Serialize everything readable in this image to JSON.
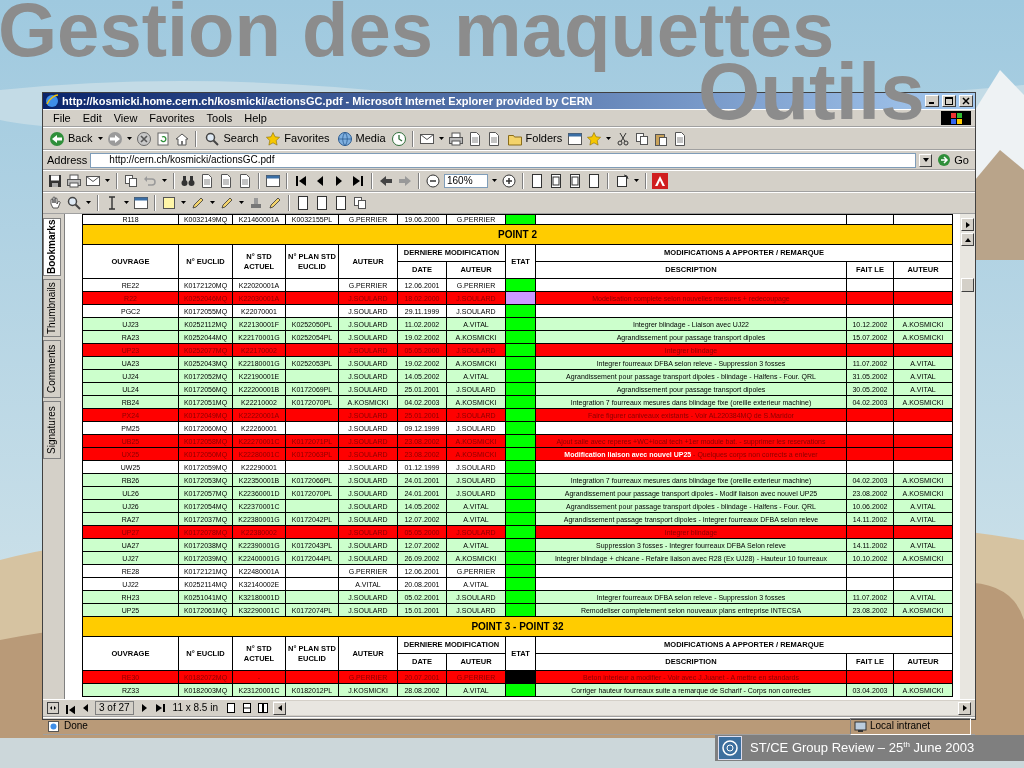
{
  "slide": {
    "title": "Gestion des maquettes",
    "subtitle": "Outils",
    "footer": "ST/CE Group Review – 25$^{th}$ June 2003"
  },
  "window": {
    "title": "http://kosmicki.home.cern.ch/kosmicki/actionsGC.pdf - Microsoft Internet Explorer provided by CERN",
    "menu": [
      "File",
      "Edit",
      "View",
      "Favorites",
      "Tools",
      "Help"
    ],
    "toolbar": [
      "Back",
      "Search",
      "Favorites",
      "Media",
      "Folders"
    ],
    "address": {
      "label": "Address",
      "url": "http://cern.ch/kosmicki/actionsGC.pdf",
      "go": "Go"
    },
    "zoom": "160%",
    "side_tabs": [
      {
        "label": "Bookmarks",
        "selected": true
      },
      {
        "label": "Thumbnails",
        "selected": false
      },
      {
        "label": "Comments",
        "selected": false
      },
      {
        "label": "Signatures",
        "selected": false
      }
    ],
    "document": {
      "top_row": {
        "ouvrage": "R118",
        "euclid": "K0032149MQ",
        "std": "K21460001A",
        "plan": "K0032155PL",
        "auteur": "G.PERRIER",
        "date": "19.06.2000",
        "modif_auteur": "G.PERRIER",
        "etat": {
          "color": "#00ff00"
        },
        "color": "#ffffff"
      },
      "sections": [
        {
          "title": "POINT 2",
          "header": {
            "ouvrage": "OUVRAGE",
            "euclid": "N° EUCLID",
            "std": "N° STD ACTUEL",
            "plan": "N° PLAN STD EUCLID",
            "auteur": "AUTEUR",
            "derniere": "DERNIERE MODIFICATION",
            "date": "DATE",
            "modif_auteur": "AUTEUR",
            "etat": "ETAT",
            "modifications": "MODIFICATIONS A APPORTER / REMARQUE",
            "description": "DESCRIPTION",
            "fait_le": "FAIT LE",
            "remarque_auteur": "AUTEUR"
          },
          "rows": [
            {
              "ouvrage": "RE22",
              "euclid": "K0172120MQ",
              "std": "K22020001A",
              "auteur": "G.PERRIER",
              "date": "12.06.2001",
              "modif_auteur": "G.PERRIER",
              "etat": {
                "color": "#00ff00"
              },
              "color": "#ffffff"
            },
            {
              "ouvrage": "R22",
              "euclid": "K0252046MQ",
              "std": "K22030001A",
              "auteur": "J.SOULARD",
              "date": "18.02.2000",
              "modif_auteur": "J.SOULARD",
              "etat": {
                "color": "#cc99ff"
              },
              "description": "Modelisation complete selon nouvelles mesures + redecoupage",
              "color": "#ff0000"
            },
            {
              "ouvrage": "PGC2",
              "euclid": "K0172055MQ",
              "std": "K22070001",
              "auteur": "J.SOULARD",
              "date": "29.11.1999",
              "modif_auteur": "J.SOULARD",
              "etat": {
                "color": "#00ff00"
              },
              "color": "#ffffff"
            },
            {
              "ouvrage": "UJ23",
              "euclid": "K0252112MQ",
              "std": "K22130001F",
              "plan": "K0252050PL",
              "auteur": "J.SOULARD",
              "date": "11.02.2002",
              "modif_auteur": "A.VITAL",
              "etat": {
                "color": "#00ff00"
              },
              "description": "Integrer blindage - Liaison avec UJ22",
              "fait_le": "10.12.2002",
              "remarque_auteur": "A.KOSMICKI",
              "color": "#ccffcc"
            },
            {
              "ouvrage": "RA23",
              "euclid": "K0252044MQ",
              "std": "K22170001G",
              "plan": "K0252054PL",
              "auteur": "J.SOULARD",
              "date": "19.02.2002",
              "modif_auteur": "A.KOSMICKI",
              "etat": {
                "color": "#00ff00"
              },
              "description": "Agrandissement pour passage transport dipoles",
              "fait_le": "15.07.2002",
              "remarque_auteur": "A.KOSMICKI",
              "color": "#ccffcc"
            },
            {
              "ouvrage": "UP23",
              "euclid": "K0252077MQ",
              "std": "K22170002",
              "auteur": "J.SOULARD",
              "date": "05.05.2000",
              "modif_auteur": "J.SOULARD",
              "etat": {
                "color": "#00ff00"
              },
              "description": "Integrer blindage",
              "color": "#ff0000"
            },
            {
              "ouvrage": "UA23",
              "euclid": "K0252043MQ",
              "std": "K22180001G",
              "plan": "K0252053PL",
              "auteur": "J.SOULARD",
              "date": "19.02.2002",
              "modif_auteur": "A.KOSMICKI",
              "etat": {
                "color": "#00ff00"
              },
              "description": "Integrer fourreaux DFBA selon releve - Suppression 3 fosses",
              "fait_le": "11.07.2002",
              "remarque_auteur": "A.VITAL",
              "color": "#ccffcc"
            },
            {
              "ouvrage": "UJ24",
              "euclid": "K0172052MQ",
              "std": "K22190001E",
              "auteur": "J.SOULARD",
              "date": "14.05.2002",
              "modif_auteur": "A.VITAL",
              "etat": {
                "color": "#00ff00"
              },
              "description": "Agrandissement pour passage transport dipoles - blindage - Halfens - Four. QRL",
              "fait_le": "31.05.2002",
              "remarque_auteur": "A.VITAL",
              "color": "#ccffcc"
            },
            {
              "ouvrage": "UL24",
              "euclid": "K0172056MQ",
              "std": "K22200001B",
              "plan": "K0172069PL",
              "auteur": "J.SOULARD",
              "date": "25.01.2001",
              "modif_auteur": "J.SOULARD",
              "etat": {
                "color": "#00ff00"
              },
              "description": "Agrandissement pour passage transport dipoles",
              "fait_le": "30.05.2002",
              "remarque_auteur": "A.VITAL",
              "color": "#ccffcc"
            },
            {
              "ouvrage": "RB24",
              "euclid": "K0172051MQ",
              "std": "K22210002",
              "plan": "K0172070PL",
              "auteur": "A.KOSMICKI",
              "date": "04.02.2003",
              "modif_auteur": "A.KOSMICKI",
              "etat": {
                "color": "#00ff00"
              },
              "description": "Integration 7 fourreaux mesures dans blindage fixe (oreille exterieur machine)",
              "fait_le": "04.02.2003",
              "remarque_auteur": "A.KOSMICKI",
              "color": "#ccffcc"
            },
            {
              "ouvrage": "PX24",
              "euclid": "K0172049MQ",
              "std": "K22220001A",
              "auteur": "J.SOULARD",
              "date": "25.01.2001",
              "modif_auteur": "J.SOULARD",
              "etat": {
                "color": "#00ff00"
              },
              "description": "Faire figurer caniveaux existants - Voir AL220384MQ de S.Maridor",
              "color": "#ff0000"
            },
            {
              "ouvrage": "PM25",
              "euclid": "K0172060MQ",
              "std": "K22260001",
              "auteur": "J.SOULARD",
              "date": "09.12.1999",
              "modif_auteur": "J.SOULARD",
              "etat": {
                "color": "#00ff00"
              },
              "color": "#ffffff"
            },
            {
              "ouvrage": "UB25",
              "euclid": "K0172058MQ",
              "std": "K22270001C",
              "plan": "K0172071PL",
              "auteur": "J.SOULARD",
              "date": "23.08.2002",
              "modif_auteur": "A.KOSMICKI",
              "etat": {
                "color": "#00ff00"
              },
              "description": "Ajout salle avec reperes +WC+local tech +1er module bat. - supprimer les reservations",
              "color": "#ff0000"
            },
            {
              "ouvrage": "UX25",
              "euclid": "K0172050MQ",
              "std": "K22280001C",
              "plan": "K0172063PL",
              "auteur": "J.SOULARD",
              "date": "23.08.2002",
              "modif_auteur": "A.KOSMICKI",
              "etat": {
                "color": "#00ff00"
              },
              "description": "**Modification liaison avec nouvel UP25** - Quelques corps non corrects a enlever",
              "color": "#ff0000"
            },
            {
              "ouvrage": "UW25",
              "euclid": "K0172059MQ",
              "std": "K22290001",
              "auteur": "J.SOULARD",
              "date": "01.12.1999",
              "modif_auteur": "J.SOULARD",
              "etat": {
                "color": "#00ff00"
              },
              "color": "#ffffff"
            },
            {
              "ouvrage": "RB26",
              "euclid": "K0172053MQ",
              "std": "K22350001B",
              "plan": "K0172066PL",
              "auteur": "J.SOULARD",
              "date": "24.01.2001",
              "modif_auteur": "J.SOULARD",
              "etat": {
                "color": "#00ff00"
              },
              "description": "Integration 7 fourreaux mesures dans blindage fixe (oreille exterieur machine)",
              "fait_le": "04.02.2003",
              "remarque_auteur": "A.KOSMICKI",
              "color": "#ccffcc"
            },
            {
              "ouvrage": "UL26",
              "euclid": "K0172057MQ",
              "std": "K22360001D",
              "plan": "K0172070PL",
              "auteur": "J.SOULARD",
              "date": "24.01.2001",
              "modif_auteur": "J.SOULARD",
              "etat": {
                "color": "#00ff00"
              },
              "description": "Agrandissement pour passage transport dipoles - Modif liaison avec nouvel UP25",
              "fait_le": "23.08.2002",
              "remarque_auteur": "A.KOSMICKI",
              "color": "#ccffcc"
            },
            {
              "ouvrage": "UJ26",
              "euclid": "K0172054MQ",
              "std": "K22370001C",
              "auteur": "J.SOULARD",
              "date": "14.05.2002",
              "modif_auteur": "A.VITAL",
              "etat": {
                "color": "#00ff00"
              },
              "description": "Agrandissement pour passage transport dipoles - blindage - Halfens - Four. QRL",
              "fait_le": "10.06.2002",
              "remarque_auteur": "A.VITAL",
              "color": "#ccffcc"
            },
            {
              "ouvrage": "RA27",
              "euclid": "K0172037MQ",
              "std": "K22380001G",
              "plan": "K0172042PL",
              "auteur": "J.SOULARD",
              "date": "12.07.2002",
              "modif_auteur": "A.VITAL",
              "etat": {
                "color": "#00ff00"
              },
              "description": "Agrandissement passage transport dipoles - Integrer fourreaux DFBA selon releve",
              "fait_le": "14.11.2002",
              "remarque_auteur": "A.VITAL",
              "color": "#ccffcc"
            },
            {
              "ouvrage": "UP27",
              "euclid": "K0172078MQ",
              "std": "K22380002",
              "auteur": "J.SOULARD",
              "date": "05.05.2000",
              "modif_auteur": "J.SOULARD",
              "etat": {
                "color": "#00ff00"
              },
              "description": "Integrer blindage",
              "color": "#ff0000"
            },
            {
              "ouvrage": "UA27",
              "euclid": "K0172038MQ",
              "std": "K22390001G",
              "plan": "K0172043PL",
              "auteur": "J.SOULARD",
              "date": "12.07.2002",
              "modif_auteur": "A.VITAL",
              "etat": {
                "color": "#00ff00"
              },
              "description": "Suppression 3 fosses - Integrer fourreaux DFBA Selon releve",
              "fait_le": "14.11.2002",
              "remarque_auteur": "A.VITAL",
              "color": "#ccffcc"
            },
            {
              "ouvrage": "UJ27",
              "euclid": "K0172039MQ",
              "std": "K22400001G",
              "plan": "K0172044PL",
              "auteur": "J.SOULARD",
              "date": "26.09.2002",
              "modif_auteur": "A.KOSMICKI",
              "etat": {
                "color": "#00ff00"
              },
              "description": "Integrer blindage + chicane - Refaire liaison avec R28 (Ex UJ28) - Hauteur 10 fourreaux",
              "fait_le": "10.10.2002",
              "remarque_auteur": "A.KOSMICKI",
              "color": "#ccffcc"
            },
            {
              "ouvrage": "RE28",
              "euclid": "K0172121MQ",
              "std": "K22480001A",
              "auteur": "G.PERRIER",
              "date": "12.06.2001",
              "modif_auteur": "G.PERRIER",
              "etat": {
                "color": "#00ff00"
              },
              "color": "#ffffff"
            },
            {
              "ouvrage": "UJ22",
              "euclid": "K0252114MQ",
              "std": "K32140002E",
              "auteur": "A.VITAL",
              "date": "20.08.2001",
              "modif_auteur": "A.VITAL",
              "etat": {
                "color": "#00ff00"
              },
              "color": "#ffffff"
            },
            {
              "ouvrage": "RH23",
              "euclid": "K0251041MQ",
              "std": "K32180001D",
              "auteur": "J.SOULARD",
              "date": "05.02.2001",
              "modif_auteur": "J.SOULARD",
              "etat": {
                "color": "#00ff00"
              },
              "description": "Integrer fourreaux DFBA selon releve - Suppression 3 fosses",
              "fait_le": "11.07.2002",
              "remarque_auteur": "A.VITAL",
              "color": "#ccffcc"
            },
            {
              "ouvrage": "UP25",
              "euclid": "K0172061MQ",
              "std": "K32290001C",
              "plan": "K0172074PL",
              "auteur": "J.SOULARD",
              "date": "15.01.2001",
              "modif_auteur": "J.SOULARD",
              "etat": {
                "color": "#00ff00"
              },
              "description": "Remodeliser completement selon nouveaux plans entreprise INTECSA",
              "fait_le": "23.08.2002",
              "remarque_auteur": "A.KOSMICKI",
              "color": "#ccffcc"
            }
          ]
        },
        {
          "title": "POINT 3 - POINT 32",
          "header": {
            "ouvrage": "OUVRAGE",
            "euclid": "N° EUCLID",
            "std": "N° STD ACTUEL",
            "plan": "N° PLAN STD EUCLID",
            "auteur": "AUTEUR",
            "derniere": "DERNIERE MODIFICATION",
            "date": "DATE",
            "modif_auteur": "AUTEUR",
            "etat": "ETAT",
            "modifications": "MODIFICATIONS A APPORTER / REMARQUE",
            "description": "DESCRIPTION",
            "fait_le": "FAIT LE",
            "remarque_auteur": "AUTEUR"
          },
          "rows": [
            {
              "ouvrage": "RE30",
              "euclid": "K0182072MQ",
              "std": "-",
              "auteur": "G.PERRIER",
              "date": "20.07.2001",
              "modif_auteur": "G.PERRIER",
              "etat": {
                "color": "#000000"
              },
              "description": "Beton interieur a modifier - Voir avec J.Juanet - A mettre en standards",
              "color": "#ff0000"
            },
            {
              "ouvrage": "RZ33",
              "euclid": "K0182003MQ",
              "std": "K23120001C",
              "plan": "K0182012PL",
              "auteur": "J.KOSMICKI",
              "date": "28.08.2002",
              "modif_auteur": "A.VITAL",
              "etat": {
                "color": "#00ff00"
              },
              "description": "Corriger hauteur fourreaux suite a remarque de Scharif - Corps non correctes",
              "fait_le": "03.04.2003",
              "remarque_auteur": "A.KOSMICKI",
              "color": "#ccffcc"
            }
          ]
        }
      ]
    },
    "page_nav": {
      "page": "3 of 27",
      "size": "11 x 8.5 in"
    },
    "status_bar": {
      "text": "Done",
      "zone": "Local intranet"
    }
  }
}
